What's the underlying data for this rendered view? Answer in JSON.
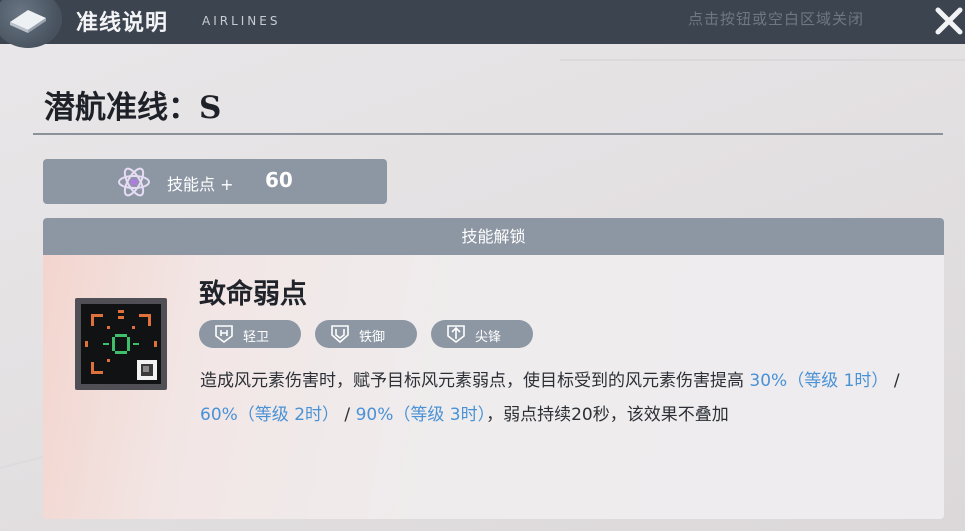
{
  "topbar": {
    "title": "准线说明",
    "subtitle": "AIRLINES",
    "hint": "点击按钮或空白区域关闭"
  },
  "heading": {
    "label": "潜航准线",
    "separator": "：",
    "grade": "S"
  },
  "skill_points": {
    "label": "技能点 +",
    "value": "60"
  },
  "unlock": {
    "header": "技能解锁",
    "skill_name": "致命弱点",
    "tags": [
      {
        "label": "轻卫",
        "icon": "light-guard-icon"
      },
      {
        "label": "铁御",
        "icon": "iron-defense-icon"
      },
      {
        "label": "尖锋",
        "icon": "spearhead-icon"
      }
    ],
    "description": {
      "p1": "造成风元素伤害时，赋予目标风元素弱点，使目标受到的风元素伤害提高",
      "v1": "30%（等级 1时）",
      "sep1": "/",
      "v2": "60%（等级 2时）",
      "sep2": "/",
      "v3": "90%（等级 3时）",
      "p2": "，弱点持续20秒，该效果不叠加"
    }
  },
  "colors": {
    "topbar": "#3c4450",
    "panel_header": "#8d97a4",
    "highlight": "#4a92d6",
    "icon_orange": "#e0713a",
    "icon_green": "#3fbf6a"
  }
}
